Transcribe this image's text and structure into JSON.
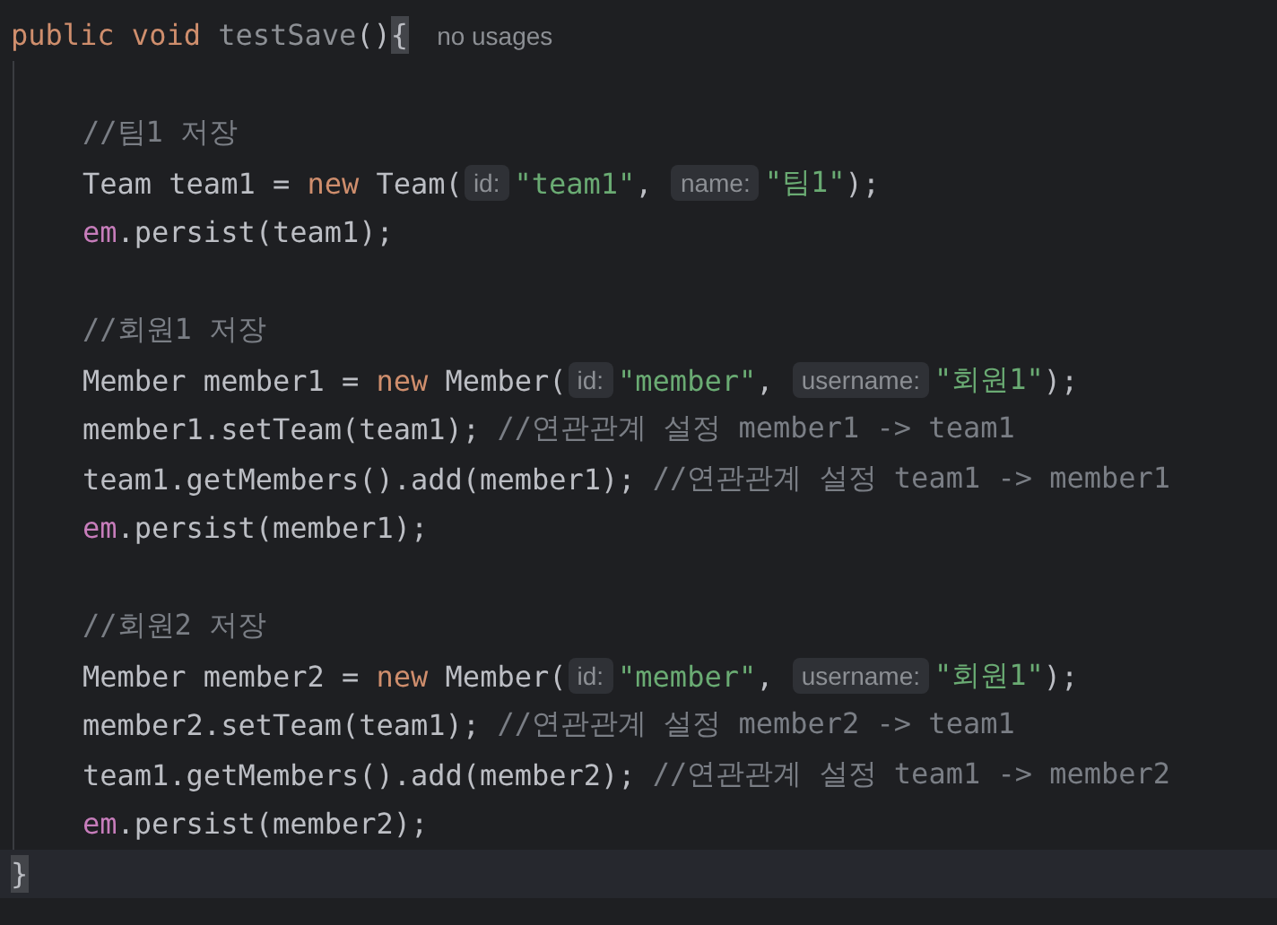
{
  "editor": {
    "header": {
      "tokens": [
        {
          "kind": "keyword",
          "text": "public void "
        },
        {
          "kind": "unused",
          "text": "testSave"
        },
        {
          "kind": "plain",
          "text": "()"
        },
        {
          "kind": "brace-match",
          "text": "{"
        },
        {
          "kind": "usage",
          "text": "no usages"
        }
      ]
    },
    "body": [
      {
        "kind": "blank"
      },
      {
        "kind": "code",
        "tokens": [
          {
            "kind": "comment",
            "text": "//팀1 저장"
          }
        ]
      },
      {
        "kind": "code",
        "tokens": [
          {
            "kind": "plain",
            "text": "Team team1 = "
          },
          {
            "kind": "keyword",
            "text": "new "
          },
          {
            "kind": "plain",
            "text": "Team("
          },
          {
            "kind": "hint",
            "text": "id:"
          },
          {
            "kind": "string",
            "text": "\"team1\""
          },
          {
            "kind": "plain",
            "text": ", "
          },
          {
            "kind": "hint",
            "text": "name:"
          },
          {
            "kind": "string",
            "text": "\"팀1\""
          },
          {
            "kind": "plain",
            "text": ");"
          }
        ]
      },
      {
        "kind": "code",
        "tokens": [
          {
            "kind": "field",
            "text": "em"
          },
          {
            "kind": "plain",
            "text": ".persist(team1);"
          }
        ]
      },
      {
        "kind": "blank"
      },
      {
        "kind": "code",
        "tokens": [
          {
            "kind": "comment",
            "text": "//회원1 저장"
          }
        ]
      },
      {
        "kind": "code",
        "tokens": [
          {
            "kind": "plain",
            "text": "Member member1 = "
          },
          {
            "kind": "keyword",
            "text": "new "
          },
          {
            "kind": "plain",
            "text": "Member("
          },
          {
            "kind": "hint",
            "text": "id:"
          },
          {
            "kind": "string",
            "text": "\"member\""
          },
          {
            "kind": "plain",
            "text": ", "
          },
          {
            "kind": "hint",
            "text": "username:"
          },
          {
            "kind": "string",
            "text": "\"회원1\""
          },
          {
            "kind": "plain",
            "text": ");"
          }
        ]
      },
      {
        "kind": "code",
        "tokens": [
          {
            "kind": "plain",
            "text": "member1.setTeam(team1); "
          },
          {
            "kind": "comment",
            "text": "//연관관계 설정 member1 -> team1"
          }
        ]
      },
      {
        "kind": "code",
        "tokens": [
          {
            "kind": "plain",
            "text": "team1.getMembers().add(member1); "
          },
          {
            "kind": "comment",
            "text": "//연관관계 설정 team1 -> member1"
          }
        ]
      },
      {
        "kind": "code",
        "tokens": [
          {
            "kind": "field",
            "text": "em"
          },
          {
            "kind": "plain",
            "text": ".persist(member1);"
          }
        ]
      },
      {
        "kind": "blank"
      },
      {
        "kind": "code",
        "tokens": [
          {
            "kind": "comment",
            "text": "//회원2 저장"
          }
        ]
      },
      {
        "kind": "code",
        "tokens": [
          {
            "kind": "plain",
            "text": "Member member2 = "
          },
          {
            "kind": "keyword",
            "text": "new "
          },
          {
            "kind": "plain",
            "text": "Member("
          },
          {
            "kind": "hint",
            "text": "id:"
          },
          {
            "kind": "string",
            "text": "\"member\""
          },
          {
            "kind": "plain",
            "text": ", "
          },
          {
            "kind": "hint",
            "text": "username:"
          },
          {
            "kind": "string",
            "text": "\"회원1\""
          },
          {
            "kind": "plain",
            "text": ");"
          }
        ]
      },
      {
        "kind": "code",
        "tokens": [
          {
            "kind": "plain",
            "text": "member2.setTeam(team1); "
          },
          {
            "kind": "comment",
            "text": "//연관관계 설정 member2 -> team1"
          }
        ]
      },
      {
        "kind": "code",
        "tokens": [
          {
            "kind": "plain",
            "text": "team1.getMembers().add(member2); "
          },
          {
            "kind": "comment",
            "text": "//연관관계 설정 team1 -> member2"
          }
        ]
      },
      {
        "kind": "code",
        "tokens": [
          {
            "kind": "field",
            "text": "em"
          },
          {
            "kind": "plain",
            "text": ".persist(member2);"
          }
        ]
      }
    ],
    "footer": {
      "current": true,
      "tokens": [
        {
          "kind": "brace-match",
          "text": "}"
        }
      ]
    }
  }
}
